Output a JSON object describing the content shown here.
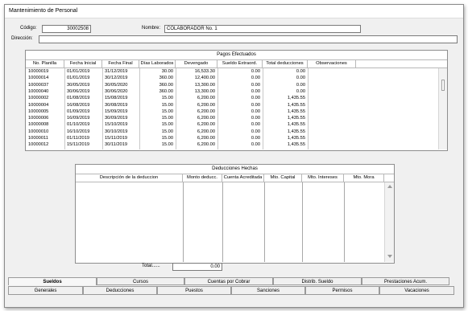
{
  "window": {
    "title": "Mantenimiento de Personal"
  },
  "employee": {
    "codigo_label": "Código:",
    "codigo_value": "30002508",
    "nombre_label": "Nombre:",
    "nombre_value": "COLABORADOR No. 1",
    "direccion_label": "Dirección:",
    "direccion_value": ""
  },
  "pagos": {
    "title": "Pagos Efectuados",
    "columns": [
      "No. Planilla",
      "Fecha Inicial",
      "Fecha Final",
      "Días Laborados",
      "Devengado",
      "Sueldo Extraord.",
      "Total deducciones",
      "Observaciones"
    ],
    "rows": [
      [
        "10000019",
        "01/01/2019",
        "31/12/2019",
        "30.00",
        "16,533.30",
        "0.00",
        "0.00",
        ""
      ],
      [
        "10000014",
        "01/01/2019",
        "30/12/2019",
        "360.00",
        "12,400.00",
        "0.00",
        "0.00",
        ""
      ],
      [
        "10000037",
        "30/05/2019",
        "30/05/2020",
        "360.00",
        "13,300.00",
        "0.00",
        "0.00",
        ""
      ],
      [
        "10000040",
        "30/06/2019",
        "30/06/2020",
        "360.00",
        "13,300.00",
        "0.00",
        "0.00",
        ""
      ],
      [
        "10000002",
        "01/08/2019",
        "15/08/2019",
        "15.00",
        "6,200.00",
        "0.00",
        "1,435.55",
        ""
      ],
      [
        "10000004",
        "16/08/2019",
        "30/08/2019",
        "15.00",
        "6,200.00",
        "0.00",
        "1,435.55",
        ""
      ],
      [
        "10000005",
        "01/09/2019",
        "15/09/2019",
        "15.00",
        "6,200.00",
        "0.00",
        "1,435.55",
        ""
      ],
      [
        "10000006",
        "16/09/2019",
        "30/09/2019",
        "15.00",
        "6,200.00",
        "0.00",
        "1,435.55",
        ""
      ],
      [
        "10000008",
        "01/10/2019",
        "15/10/2019",
        "15.00",
        "6,200.00",
        "0.00",
        "1,435.55",
        ""
      ],
      [
        "10000010",
        "16/10/2019",
        "30/10/2019",
        "15.00",
        "6,200.00",
        "0.00",
        "1,435.55",
        ""
      ],
      [
        "10000011",
        "01/11/2019",
        "15/11/2019",
        "15.00",
        "6,200.00",
        "0.00",
        "1,435.55",
        ""
      ],
      [
        "10000012",
        "15/11/2019",
        "30/11/2019",
        "15.00",
        "6,200.00",
        "0.00",
        "1,435.55",
        ""
      ]
    ]
  },
  "deducciones": {
    "title": "Deducciones Hechas",
    "columns": [
      "Descripción de la deduccion",
      "Monto deducc.",
      "Cuenta Acreditada",
      "Mto. Capital",
      "Mto. Intereses",
      "Mto. Mora"
    ],
    "total_label": "Total......",
    "total_value": "0.00"
  },
  "tabs_row1": [
    "Sueldos",
    "Cursos",
    "Cuentas por Cobrar",
    "Distrib. Sueldo",
    "Prestaciones Acum."
  ],
  "tabs_row2": [
    "Generales",
    "Deducciones",
    "Puestos",
    "Sanciones",
    "Permisos",
    "Vacaciones"
  ],
  "active_tab": "Sueldos"
}
